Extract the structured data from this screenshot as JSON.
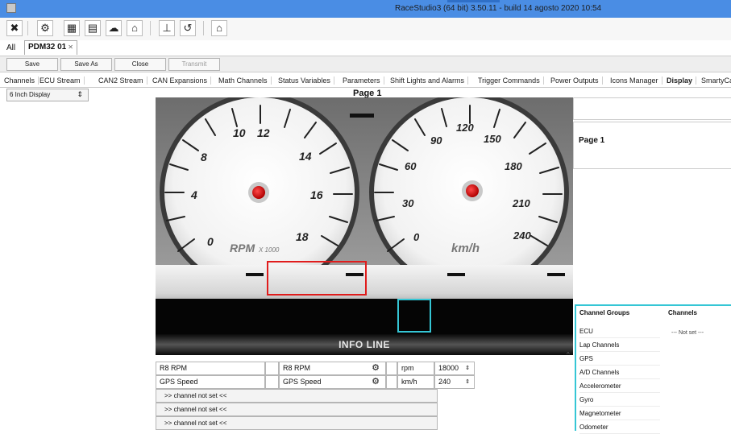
{
  "window": {
    "title": "RaceStudio3 (64 bit) 3.50.11 - build 14 agosto 2020 10:54"
  },
  "toolbar": {
    "icons": [
      "tools-icon",
      "gear-icon",
      "device-icon",
      "config-icon",
      "cloud-icon",
      "download-icon",
      "upload-icon",
      "add-icon",
      "settings-icon"
    ],
    "glyphs": [
      "✖",
      "⚙",
      "▦",
      "▤",
      "☁",
      "⌂",
      "⊥",
      "↺",
      "⌂"
    ]
  },
  "tabs": {
    "all_label": "All",
    "doc_label": "PDM32 01",
    "close_glyph": "✕"
  },
  "actions": {
    "save": "Save",
    "save_as": "Save As",
    "close": "Close",
    "transmit": "Transmit"
  },
  "menu": {
    "items": [
      "Channels",
      "ECU Stream",
      "CAN2 Stream",
      "CAN Expansions",
      "Math Channels",
      "Status Variables",
      "Parameters",
      "Shift Lights and Alarms",
      "Trigger Commands",
      "Power Outputs",
      "Icons Manager",
      "Display",
      "SmartyCa"
    ],
    "active_index": 11
  },
  "display_select": {
    "value": "6 Inch Display",
    "arrow": "⇕"
  },
  "page_title": "Page 1",
  "dashboard": {
    "rpm_gauge": {
      "unit": "RPM",
      "unit_suffix": "X 1000",
      "ticks": [
        "0",
        "4",
        "8",
        "10",
        "12",
        "14",
        "16",
        "18"
      ]
    },
    "speed_gauge": {
      "unit": "km/h",
      "ticks": [
        "0",
        "30",
        "60",
        "90",
        "120",
        "150",
        "180",
        "210",
        "240"
      ]
    },
    "info_line": "INFO LINE"
  },
  "channel_rows": [
    {
      "channel": "R8 RPM",
      "label": "R8 RPM",
      "unit": "rpm",
      "max": "18000"
    },
    {
      "channel": "GPS Speed",
      "label": "GPS Speed",
      "unit": "km/h",
      "max": "240"
    }
  ],
  "empty_rows": [
    ">>  channel not set  <<",
    ">>  channel not set  <<",
    ">>  channel not set  <<"
  ],
  "right_panel": {
    "page_label": "Page 1",
    "groups_header": "Channel Groups",
    "channels_header": "Channels",
    "groups": [
      "ECU",
      "Lap Channels",
      "GPS",
      "A/D Channels",
      "Accelerometer",
      "Gyro",
      "Magnetometer",
      "Odometer"
    ],
    "not_set": "--- Not set ---"
  },
  "colors": {
    "titlebar": "#4a8de4",
    "highlight_red": "#e01c1c",
    "highlight_cyan": "#35c6d5",
    "needle_hub": "#d40000"
  }
}
